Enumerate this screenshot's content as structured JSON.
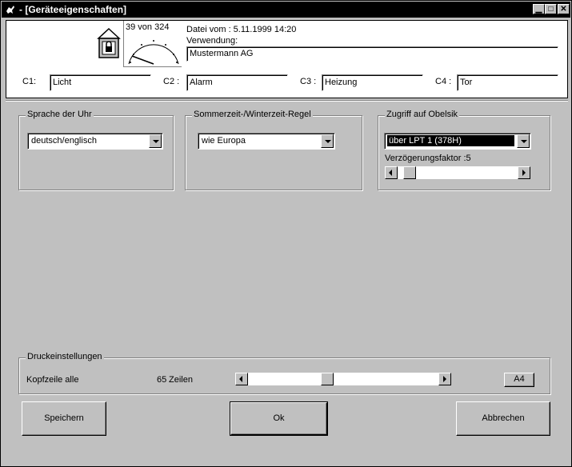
{
  "window": {
    "title": "- [Geräteeigenschaften]",
    "controls": {
      "minimize": "▁",
      "maximize": "□",
      "close": "✕"
    }
  },
  "header": {
    "counter": "39 von 324",
    "date_label": "Datei vom : 5.11.1999 14:20",
    "usage_label": "Verwendung:",
    "usage_value": "Mustermann AG",
    "channels": [
      {
        "label": "C1:",
        "value": "Licht"
      },
      {
        "label": "C2 :",
        "value": "Alarm"
      },
      {
        "label": "C3 :",
        "value": "Heizung"
      },
      {
        "label": "C4 :",
        "value": "Tor"
      }
    ]
  },
  "groups": {
    "language": {
      "legend": "Sprache der Uhr",
      "value": "deutsch/englisch"
    },
    "dst": {
      "legend": "Sommerzeit-/Winterzeit-Regel",
      "value": "wie Europa"
    },
    "access": {
      "legend": "Zugriff auf Obelsik",
      "value": "über LPT 1 (378H)",
      "delay_label": "Verzögerungsfaktor :5",
      "delay_level": 0.05
    },
    "print": {
      "legend": "Druckeinstellungen",
      "header_label": "Kopfzeile alle",
      "lines_value": "65",
      "lines_unit": "Zeilen",
      "slider_level": 0.41,
      "paper_button": "A4"
    }
  },
  "buttons": {
    "save": "Speichern",
    "ok": "Ok",
    "cancel": "Abbrechen"
  }
}
